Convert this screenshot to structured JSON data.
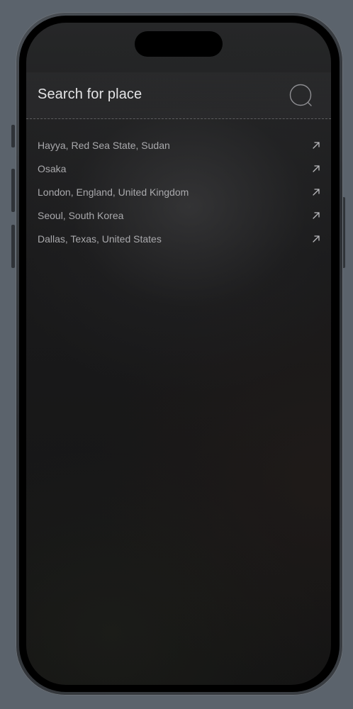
{
  "header": {
    "title": "Search for place",
    "search_icon": "search-icon"
  },
  "results": [
    {
      "label": "Hayya, Red Sea State, Sudan",
      "icon": "arrow-up-right-icon"
    },
    {
      "label": "Osaka",
      "icon": "arrow-up-right-icon"
    },
    {
      "label": "London, England, United Kingdom",
      "icon": "arrow-up-right-icon"
    },
    {
      "label": "Seoul, South Korea",
      "icon": "arrow-up-right-icon"
    },
    {
      "label": "Dallas, Texas, United States",
      "icon": "arrow-up-right-icon"
    }
  ],
  "colors": {
    "background": "#5b636c",
    "screen": "#1a1a1b",
    "title_text": "#e4e4e6",
    "item_text": "#a9a9ac"
  }
}
